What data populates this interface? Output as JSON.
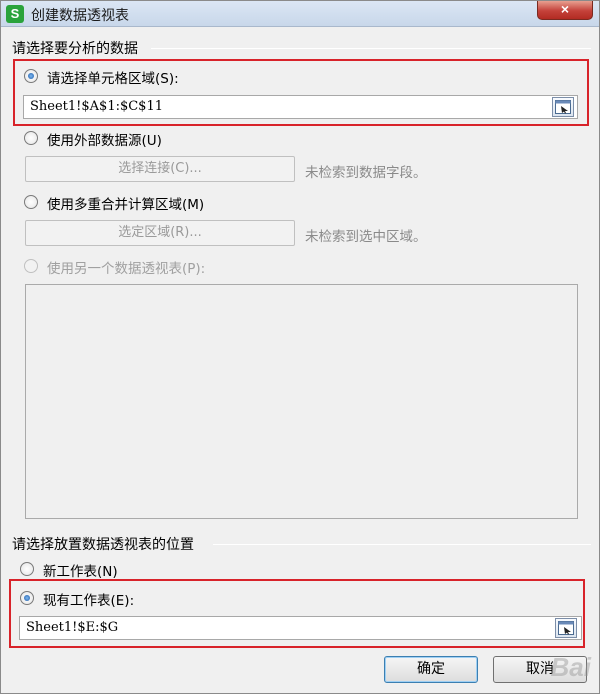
{
  "window": {
    "title": "创建数据透视表",
    "app_icon": "S",
    "close_label": "×"
  },
  "source_group": {
    "title": "请选择要分析的数据",
    "option_range": {
      "label": "请选择单元格区域(S):",
      "value": "Sheet1!$A$1:$C$11",
      "checked": true
    },
    "option_external": {
      "label": "使用外部数据源(U)",
      "button": "选择连接(C)...",
      "hint": "未检索到数据字段。"
    },
    "option_multi": {
      "label": "使用多重合并计算区域(M)",
      "button": "选定区域(R)...",
      "hint": "未检索到选中区域。"
    },
    "option_other_pivot": {
      "label": "使用另一个数据透视表(P):",
      "disabled": true
    }
  },
  "placement_group": {
    "title": "请选择放置数据透视表的位置",
    "option_new_sheet": {
      "label": "新工作表(N)"
    },
    "option_existing_sheet": {
      "label": "现有工作表(E):",
      "value": "Sheet1!$E:$G",
      "checked": true
    }
  },
  "footer": {
    "ok_label": "确定",
    "cancel_label": "取消"
  },
  "colors": {
    "highlight": "#d8232a",
    "app_icon": "#2aa33c"
  },
  "watermark": "Bai"
}
